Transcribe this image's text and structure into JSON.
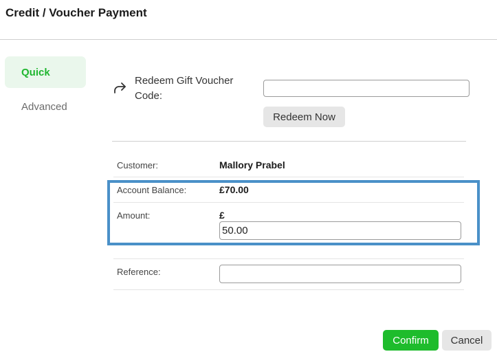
{
  "header": {
    "title": "Credit / Voucher Payment"
  },
  "tabs": [
    {
      "label": "Quick",
      "active": true
    },
    {
      "label": "Advanced",
      "active": false
    }
  ],
  "redeem": {
    "label": "Redeem Gift Voucher Code:",
    "input_value": "",
    "button_label": "Redeem Now",
    "icon": "redo-arrow-icon"
  },
  "customer": {
    "label": "Customer:",
    "value": "Mallory Prabel"
  },
  "account_balance": {
    "label": "Account Balance:",
    "value": "£70.00"
  },
  "amount": {
    "label": "Amount:",
    "currency": "£",
    "value": "50.00"
  },
  "reference": {
    "label": "Reference:",
    "value": ""
  },
  "footer": {
    "confirm_label": "Confirm",
    "cancel_label": "Cancel"
  },
  "colors": {
    "accent": "#1ebc2c",
    "highlight_border": "#4a90c8",
    "active_tab_bg": "#eaf7ec"
  }
}
